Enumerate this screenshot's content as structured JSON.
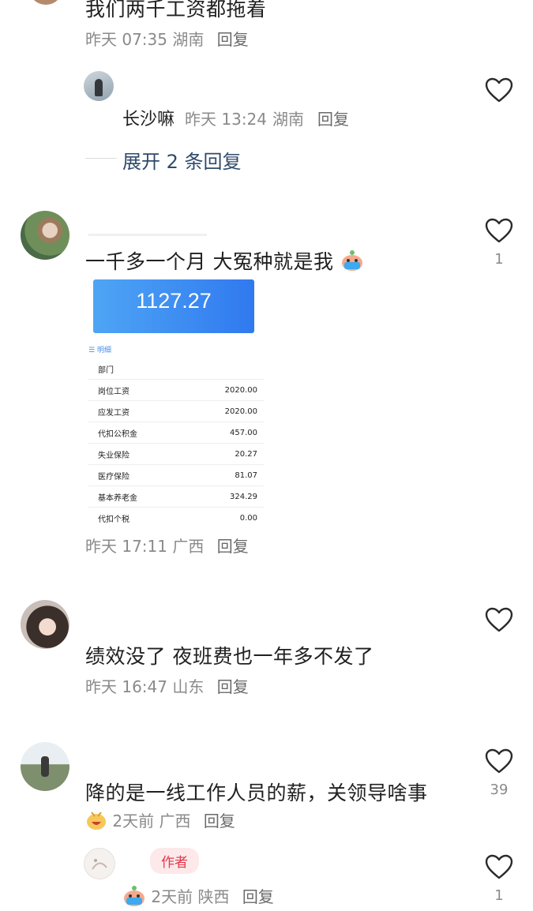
{
  "top_comment": {
    "text": "我们两千工资都拖着",
    "time": "昨天 07:35",
    "location": "湖南",
    "reply_label": "回复"
  },
  "reply_1": {
    "author": "长沙嘛",
    "time": "昨天 13:24",
    "location": "湖南",
    "reply_label": "回复"
  },
  "expand": {
    "label": "展开 2 条回复"
  },
  "comment_2": {
    "text": "一千多一个月 大冤种就是我",
    "likes": "1",
    "time": "昨天 17:11",
    "location": "广西",
    "reply_label": "回复",
    "image": {
      "amount": "1127.27",
      "detail_title": "明细",
      "rows": [
        {
          "label": "部门",
          "value": ""
        },
        {
          "label": "岗位工资",
          "value": "2020.00"
        },
        {
          "label": "应发工资",
          "value": "2020.00"
        },
        {
          "label": "代扣公积金",
          "value": "457.00"
        },
        {
          "label": "失业保险",
          "value": "20.27"
        },
        {
          "label": "医疗保险",
          "value": "81.07"
        },
        {
          "label": "基本养老金",
          "value": "324.29"
        },
        {
          "label": "代扣个税",
          "value": "0.00"
        }
      ]
    }
  },
  "comment_3": {
    "text": "绩效没了 夜班费也一年多不发了",
    "time": "昨天 16:47",
    "location": "山东",
    "reply_label": "回复"
  },
  "comment_4": {
    "text": "降的是一线工作人员的薪，关领导啥事",
    "likes": "39",
    "time": "2天前",
    "location": "广西",
    "reply_label": "回复"
  },
  "reply_author": {
    "badge": "作者",
    "likes": "1",
    "time": "2天前",
    "location": "陕西",
    "reply_label": "回复"
  },
  "icons": {
    "like": "heart-outline-icon",
    "menu": "list-icon",
    "emoji_crying": "crying-face-emoji",
    "emoji_laugh": "laughing-face-emoji"
  }
}
